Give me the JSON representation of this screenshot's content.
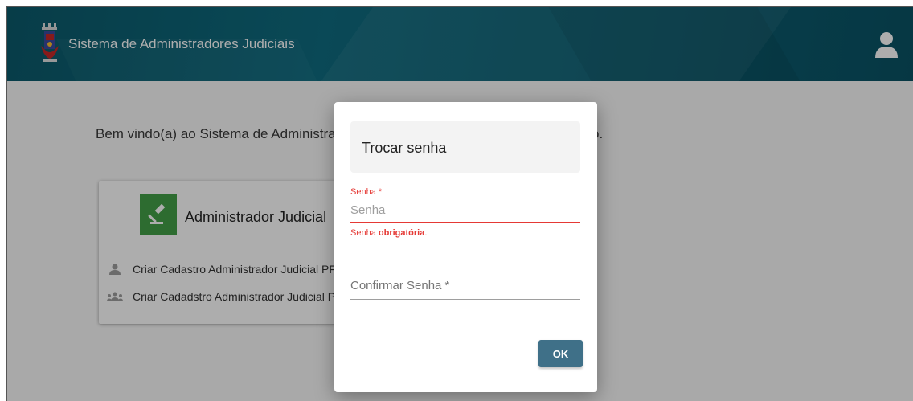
{
  "header": {
    "title": "Sistema de Administradores Judiciais",
    "logo_icon": "coat-of-arms-icon",
    "user_icon": "user-icon"
  },
  "main": {
    "welcome_text": "Bem vindo(a) ao Sistema de Administradores Judiciais, selecione o Perfil Desejado.",
    "card": {
      "title": "Administrador Judicial",
      "icon": "gavel-icon",
      "items": [
        {
          "label": "Criar Cadastro Administrador Judicial PF",
          "icon": "person-icon"
        },
        {
          "label": "Criar Cadadstro Administrador Judicial PJ",
          "icon": "group-icon"
        }
      ]
    }
  },
  "dialog": {
    "title": "Trocar senha",
    "password": {
      "label": "Senha *",
      "placeholder": "Senha",
      "error_prefix": "Senha ",
      "error_bold": "obrigatória",
      "error_suffix": "."
    },
    "confirm": {
      "placeholder": "Confirmar Senha *"
    },
    "ok_label": "OK"
  },
  "colors": {
    "header": "#0f6c80",
    "accent_green": "#43a047",
    "error": "#e53935",
    "button": "#3f7088"
  }
}
